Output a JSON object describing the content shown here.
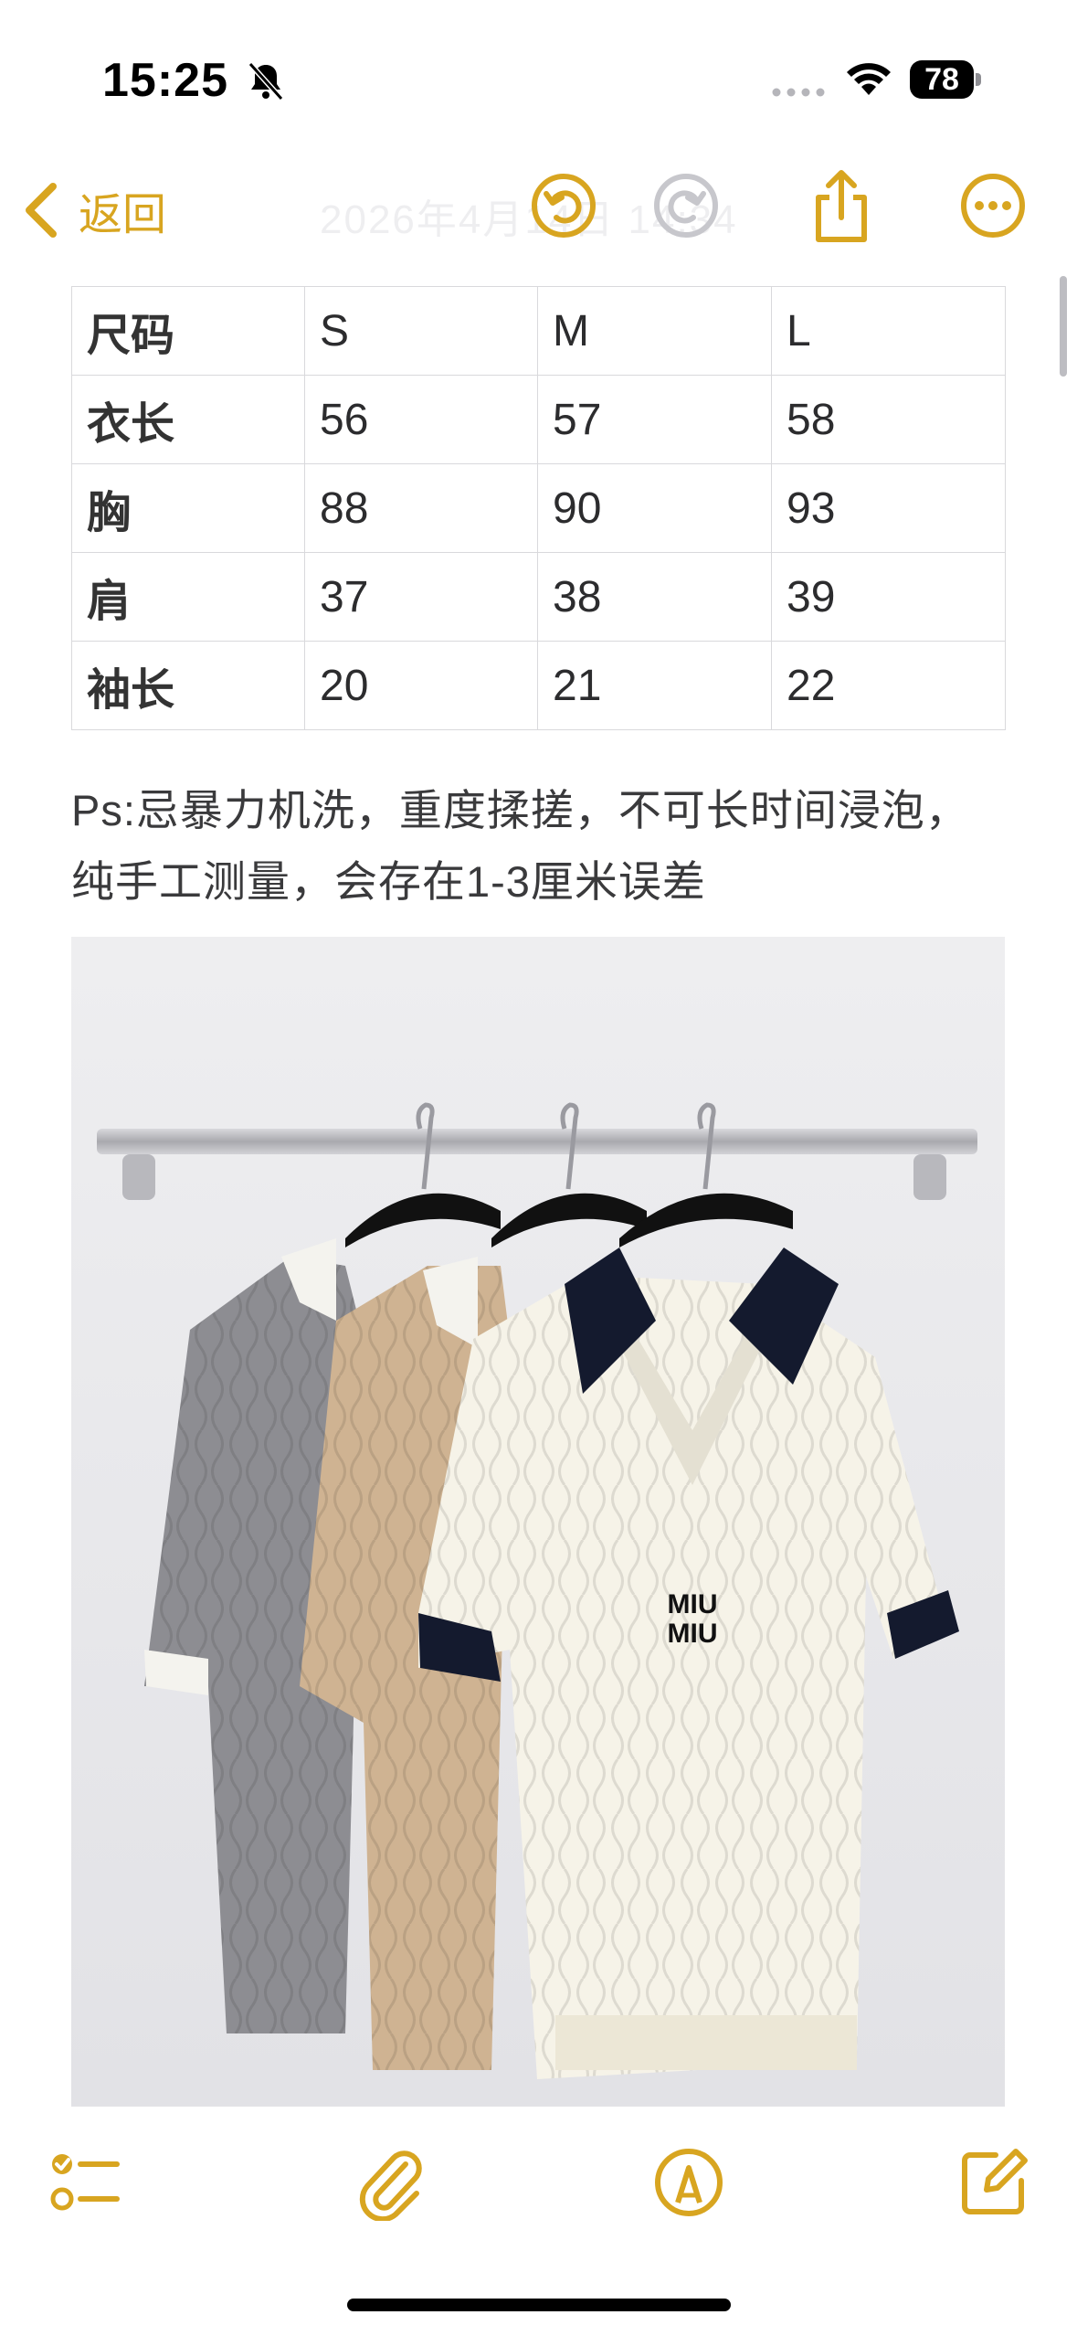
{
  "status_bar": {
    "time": "15:25",
    "battery": "78"
  },
  "nav": {
    "back_label": "返回",
    "faded_title": "2026年4月14日 14:34",
    "accent": "#d8a520"
  },
  "size_table": {
    "headers": [
      "尺码",
      "S",
      "M",
      "L"
    ],
    "rows": [
      [
        "衣长",
        "56",
        "57",
        "58"
      ],
      [
        "胸",
        "88",
        "90",
        "93"
      ],
      [
        "肩",
        "37",
        "38",
        "39"
      ],
      [
        "袖长",
        "20",
        "21",
        "22"
      ]
    ]
  },
  "note": "Ps:忌暴力机洗，重度揉搓，不可长时间浸泡，纯手工测量，会存在1-3厘米误差",
  "photo": {
    "label_text": "MIU MIU",
    "description_icons": [
      "hanger-rail",
      "sweater-grey",
      "sweater-beige",
      "sweater-cream"
    ]
  },
  "toolbar": {
    "icons": [
      "checklist-icon",
      "attachment-icon",
      "markup-icon",
      "compose-icon"
    ]
  }
}
